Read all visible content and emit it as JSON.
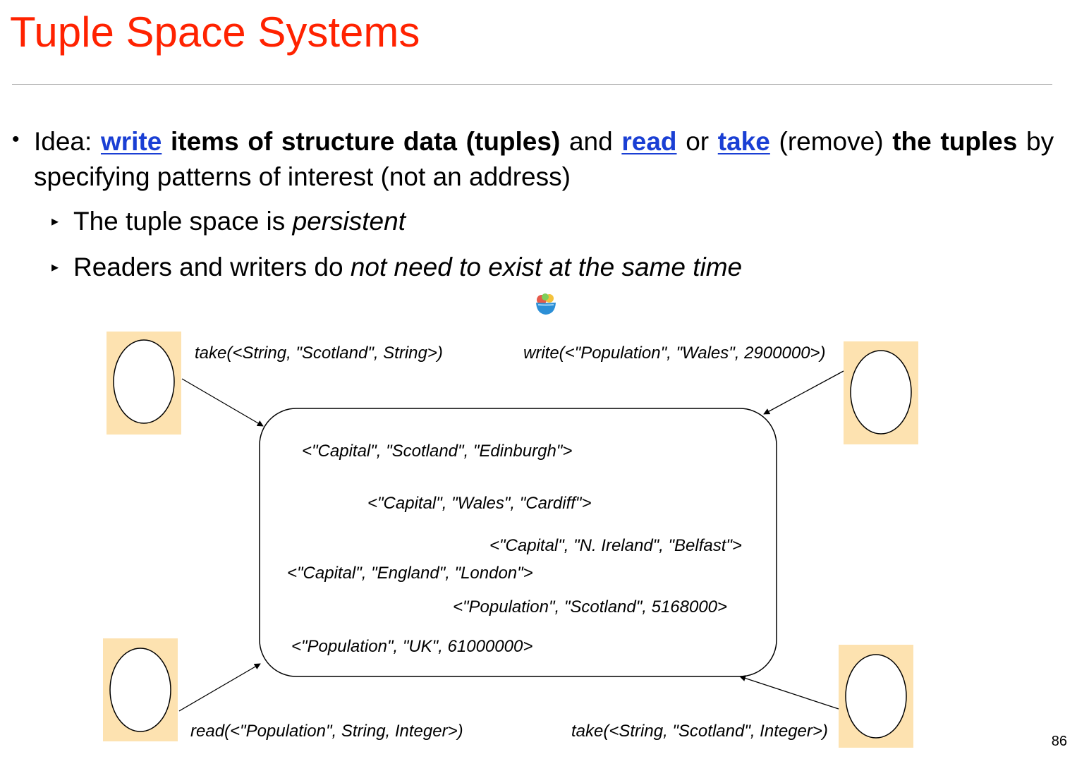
{
  "slide": {
    "title": "Tuple Space Systems",
    "page_number": "86"
  },
  "bullet": {
    "idea_label": "Idea:",
    "write_link": "write",
    "phrase1": "items of structure data (tuples)",
    "and_text": "and",
    "read_link": "read",
    "or_text": "or",
    "take_link": "take",
    "remove_text": "(remove)",
    "the_text": "the",
    "tuples_text": "tuples",
    "tail_text": "by specifying patterns of interest (not an address)"
  },
  "subbullets": {
    "one_prefix": "The tuple space is",
    "one_emph": "persistent",
    "two_prefix": "Readers and writers do",
    "two_emph": "not need to exist at the same time"
  },
  "diagram": {
    "op_top_left": "take(<String, \"Scotland\", String>)",
    "op_top_right": "write(<\"Population\", \"Wales\", 2900000>)",
    "op_bottom_left": "read(<\"Population\", String, Integer>)",
    "op_bottom_right": "take(<String, \"Scotland\", Integer>)",
    "tuples": [
      "<\"Capital\", \"Scotland\", \"Edinburgh\">",
      "<\"Capital\", \"Wales\", \"Cardiff\">",
      "<\"Capital\", \"N. Ireland\", \"Belfast\">",
      "<\"Capital\", \"England\", \"London\">",
      "<\"Population\", \"Scotland\", 5168000>",
      "<\"Population\", \"UK\", 61000000>"
    ],
    "process_box_color": "#fde2b0"
  }
}
